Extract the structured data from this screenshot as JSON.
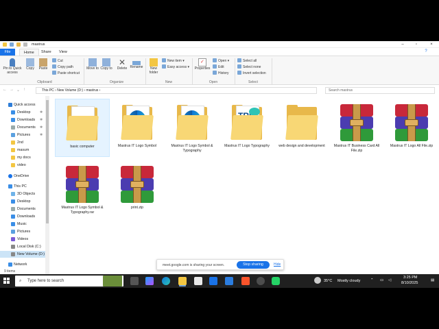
{
  "window": {
    "title": "mastrus"
  },
  "tabs": [
    "File",
    "Home",
    "Share",
    "View"
  ],
  "ribbon": {
    "clipboard": {
      "pin": "Pin to Quick access",
      "copy": "Copy",
      "paste": "Paste",
      "cut": "Cut",
      "copy_path": "Copy path",
      "paste_shortcut": "Paste shortcut",
      "group": "Clipboard"
    },
    "organize": {
      "move_to": "Move to",
      "copy_to": "Copy to",
      "delete": "Delete",
      "rename": "Rename",
      "group": "Organize"
    },
    "new": {
      "new_folder": "New folder",
      "new_item": "New item",
      "easy_access": "Easy access",
      "group": "New"
    },
    "open": {
      "properties": "Properties",
      "open": "Open",
      "edit": "Edit",
      "history": "History",
      "group": "Open"
    },
    "select": {
      "select_all": "Select all",
      "select_none": "Select none",
      "invert": "Invert selection",
      "group": "Select"
    }
  },
  "address": {
    "crumbs": [
      "This PC",
      "New Volume (D:)",
      "mastrus"
    ],
    "search_placeholder": "Search mastrus"
  },
  "nav": {
    "quick_access": "Quick access",
    "items": [
      "Desktop",
      "Downloads",
      "Documents",
      "Pictures",
      "2nd",
      "masum",
      "my docs",
      "video"
    ],
    "onedrive": "OneDrive",
    "this_pc": "This PC",
    "pc_items": [
      "3D Objects",
      "Desktop",
      "Documents",
      "Downloads",
      "Music",
      "Pictures",
      "Videos",
      "Local Disk (C:)",
      "New Volume (D:)"
    ],
    "network": "Network"
  },
  "files": [
    {
      "name": "basic computer",
      "type": "folder-pdf"
    },
    {
      "name": "Mastrus IT Logo Symbol",
      "type": "folder-edge"
    },
    {
      "name": "Mastrus IT Logo Symbol & Typography",
      "type": "folder-edge"
    },
    {
      "name": "Mastrus IT Logo Typography",
      "type": "folder-tru"
    },
    {
      "name": "web design and development",
      "type": "folder"
    },
    {
      "name": "Mastrus IT Business Card All File.zip",
      "type": "rar"
    },
    {
      "name": "Mastrus IT Logo All File.zip",
      "type": "rar"
    },
    {
      "name": "Mastrus IT Logo Symbol & Typography.rar",
      "type": "rar"
    },
    {
      "name": "print.zip",
      "type": "rar"
    }
  ],
  "status": "9 items",
  "share_bar": {
    "message": "meet.google.com is sharing your screen.",
    "stop": "Stop sharing",
    "hide": "Hide"
  },
  "taskbar": {
    "search_placeholder": "Type here to search",
    "weather_temp": "35°C",
    "weather_text": "Mostly cloudy",
    "time": "3:25 PM",
    "date": "8/10/2025"
  },
  "colors": {
    "accent": "#1a73e8",
    "selected": "#cce4f7",
    "taskbar": "#202020"
  }
}
